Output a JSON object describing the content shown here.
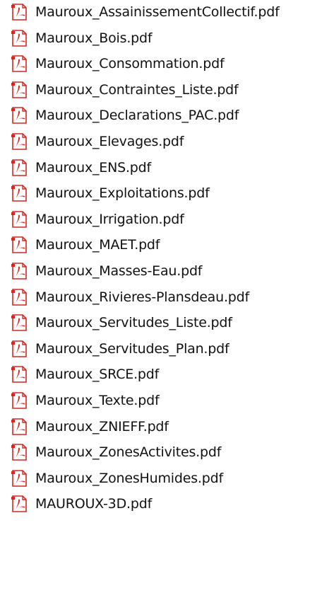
{
  "files": [
    {
      "name": "Mauroux_AssainissementCollectif.pdf",
      "icon": "pdf-icon"
    },
    {
      "name": "Mauroux_Bois.pdf",
      "icon": "pdf-icon"
    },
    {
      "name": "Mauroux_Consommation.pdf",
      "icon": "pdf-icon"
    },
    {
      "name": "Mauroux_Contraintes_Liste.pdf",
      "icon": "pdf-icon"
    },
    {
      "name": "Mauroux_Declarations_PAC.pdf",
      "icon": "pdf-icon"
    },
    {
      "name": "Mauroux_Elevages.pdf",
      "icon": "pdf-icon"
    },
    {
      "name": "Mauroux_ENS.pdf",
      "icon": "pdf-icon"
    },
    {
      "name": "Mauroux_Exploitations.pdf",
      "icon": "pdf-icon"
    },
    {
      "name": "Mauroux_Irrigation.pdf",
      "icon": "pdf-icon"
    },
    {
      "name": "Mauroux_MAET.pdf",
      "icon": "pdf-icon"
    },
    {
      "name": "Mauroux_Masses-Eau.pdf",
      "icon": "pdf-icon"
    },
    {
      "name": "Mauroux_Rivieres-Plansdeau.pdf",
      "icon": "pdf-icon"
    },
    {
      "name": "Mauroux_Servitudes_Liste.pdf",
      "icon": "pdf-icon"
    },
    {
      "name": "Mauroux_Servitudes_Plan.pdf",
      "icon": "pdf-icon"
    },
    {
      "name": "Mauroux_SRCE.pdf",
      "icon": "pdf-icon"
    },
    {
      "name": "Mauroux_Texte.pdf",
      "icon": "pdf-icon"
    },
    {
      "name": "Mauroux_ZNIEFF.pdf",
      "icon": "pdf-icon"
    },
    {
      "name": "Mauroux_ZonesActivites.pdf",
      "icon": "pdf-icon"
    },
    {
      "name": "Mauroux_ZonesHumides.pdf",
      "icon": "pdf-icon"
    },
    {
      "name": "MAUROUX-3D.pdf",
      "icon": "pdf-icon"
    }
  ],
  "colors": {
    "icon_red": "#d5271f",
    "icon_paper": "#ffffff",
    "text": "#111111"
  }
}
